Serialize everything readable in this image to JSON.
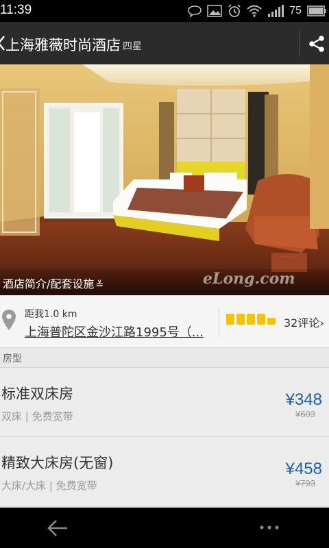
{
  "status_bar": {
    "time": "11:39",
    "battery": "75"
  },
  "action_bar": {
    "title": "上海雅薇时尚酒店",
    "star_rating": "四星"
  },
  "hero": {
    "intro_label": "酒店简介/配套设施",
    "watermark": "eLong.com"
  },
  "location": {
    "distance": "距我1.0 km",
    "address": "上海普陀区金沙江路1995号（...",
    "rating_blocks": 4.5,
    "reviews": "32评论"
  },
  "rooms_section": {
    "header": "房型"
  },
  "rooms": [
    {
      "name": "标准双床房",
      "features": "双床 | 免费宽带",
      "price": "¥348",
      "original_price": "¥603"
    },
    {
      "name": "精致大床房(无窗)",
      "features": "大床/大床 | 免费宽带",
      "price": "¥458",
      "original_price": "¥793"
    }
  ],
  "colors": {
    "accent": "#1f5fa6",
    "rating": "#f5c400",
    "action_bar": "#2b2b2b"
  }
}
